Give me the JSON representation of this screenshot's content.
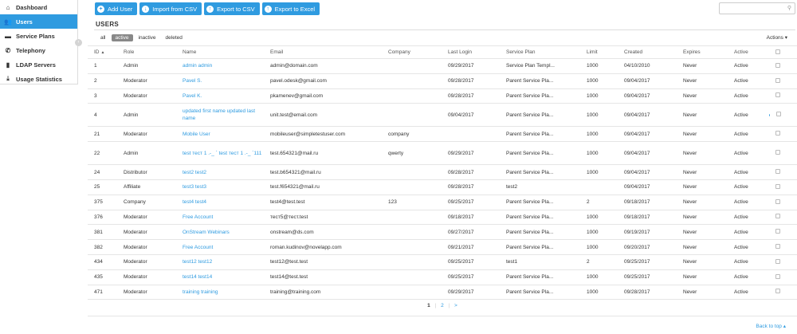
{
  "sidebar": {
    "items": [
      {
        "label": "Dashboard",
        "icon": "home-icon",
        "glyph": "⌂",
        "active": false
      },
      {
        "label": "Users",
        "icon": "users-icon",
        "glyph": "👥",
        "active": true
      },
      {
        "label": "Service Plans",
        "icon": "folder-icon",
        "glyph": "▬",
        "active": false
      },
      {
        "label": "Telephony",
        "icon": "phone-icon",
        "glyph": "✆",
        "active": false
      },
      {
        "label": "LDAP Servers",
        "icon": "server-icon",
        "glyph": "▮",
        "active": false
      },
      {
        "label": "Usage Statistics",
        "icon": "download-icon",
        "glyph": "⤓",
        "active": false
      }
    ],
    "collapse_glyph": "‹"
  },
  "toolbar": {
    "add_user": "Add User",
    "import_csv": "Import from CSV",
    "export_csv": "Export to CSV",
    "export_excel": "Export to Excel"
  },
  "search": {
    "placeholder": ""
  },
  "page": {
    "title": "USERS"
  },
  "filters": {
    "all": "all",
    "active": "active",
    "inactive": "inactive",
    "deleted": "deleted"
  },
  "actions_label": "Actions ▾",
  "table": {
    "columns": [
      "ID",
      "Role",
      "Name",
      "Email",
      "Company",
      "Last Login",
      "Service Plan",
      "Limit",
      "Created",
      "Expires",
      "Active"
    ],
    "rows": [
      {
        "id": "1",
        "role": "Admin",
        "name": "admin admin",
        "email": "admin@domain.com",
        "company": "",
        "last_login": "09/29/2017",
        "plan": "Service Plan Templ...",
        "limit": "1000",
        "created": "04/10/2010",
        "expires": "Never",
        "active": "Active",
        "dot": false
      },
      {
        "id": "2",
        "role": "Moderator",
        "name": "Pavel S.",
        "email": "pavel.odesk@gmail.com",
        "company": "",
        "last_login": "09/28/2017",
        "plan": "Parent Service Pla...",
        "limit": "1000",
        "created": "09/04/2017",
        "expires": "Never",
        "active": "Active",
        "dot": false
      },
      {
        "id": "3",
        "role": "Moderator",
        "name": "Pavel K.",
        "email": "pkamenev@gmail.com",
        "company": "",
        "last_login": "09/28/2017",
        "plan": "Parent Service Pla...",
        "limit": "1000",
        "created": "09/04/2017",
        "expires": "Never",
        "active": "Active",
        "dot": false
      },
      {
        "id": "4",
        "role": "Admin",
        "name": "updated first name updated last name",
        "email": "unit.test@email.com",
        "company": "",
        "last_login": "09/04/2017",
        "plan": "Parent Service Pla...",
        "limit": "1000",
        "created": "09/04/2017",
        "expires": "Never",
        "active": "Active",
        "dot": true
      },
      {
        "id": "21",
        "role": "Moderator",
        "name": "Mobile User",
        "email": "mobileuser@simpletestuser.com",
        "company": "company",
        "last_login": "",
        "plan": "Parent Service Pla...",
        "limit": "1000",
        "created": "09/04/2017",
        "expires": "Never",
        "active": "Active",
        "dot": false
      },
      {
        "id": "22",
        "role": "Admin",
        "name": "test тест 1 .-_ ` test тест 1 .-_ `111",
        "email": "test.654321@mail.ru",
        "company": "qwerty",
        "last_login": "09/29/2017",
        "plan": "Parent Service Pla...",
        "limit": "1000",
        "created": "09/04/2017",
        "expires": "Never",
        "active": "Active",
        "dot": false
      },
      {
        "id": "24",
        "role": "Distributor",
        "name": "test2 test2",
        "email": "test.b654321@mail.ru",
        "company": "",
        "last_login": "09/28/2017",
        "plan": "Parent Service Pla...",
        "limit": "1000",
        "created": "09/04/2017",
        "expires": "Never",
        "active": "Active",
        "dot": false
      },
      {
        "id": "25",
        "role": "Affiliate",
        "name": "test3 test3",
        "email": "test.f654321@mail.ru",
        "company": "",
        "last_login": "09/28/2017",
        "plan": "test2",
        "limit": "",
        "created": "09/04/2017",
        "expires": "Never",
        "active": "Active",
        "dot": false
      },
      {
        "id": "375",
        "role": "Company",
        "name": "test4 test4",
        "email": "test4@test.test",
        "company": "123",
        "last_login": "09/25/2017",
        "plan": "Parent Service Pla...",
        "limit": "2",
        "created": "09/18/2017",
        "expires": "Never",
        "active": "Active",
        "dot": false
      },
      {
        "id": "376",
        "role": "Moderator",
        "name": "Free Account",
        "email": "тест5@тест.test",
        "company": "",
        "last_login": "09/18/2017",
        "plan": "Parent Service Pla...",
        "limit": "1000",
        "created": "09/18/2017",
        "expires": "Never",
        "active": "Active",
        "dot": false
      },
      {
        "id": "381",
        "role": "Moderator",
        "name": "OnStream Webinars",
        "email": "onstream@ds.com",
        "company": "",
        "last_login": "09/27/2017",
        "plan": "Parent Service Pla...",
        "limit": "1000",
        "created": "09/19/2017",
        "expires": "Never",
        "active": "Active",
        "dot": false
      },
      {
        "id": "382",
        "role": "Moderator",
        "name": "Free Account",
        "email": "roman.kudinov@novelapp.com",
        "company": "",
        "last_login": "09/21/2017",
        "plan": "Parent Service Pla...",
        "limit": "1000",
        "created": "09/20/2017",
        "expires": "Never",
        "active": "Active",
        "dot": false
      },
      {
        "id": "434",
        "role": "Moderator",
        "name": "test12 test12",
        "email": "test12@test.test",
        "company": "",
        "last_login": "09/25/2017",
        "plan": "test1",
        "limit": "2",
        "created": "09/25/2017",
        "expires": "Never",
        "active": "Active",
        "dot": false
      },
      {
        "id": "435",
        "role": "Moderator",
        "name": "test14 test14",
        "email": "test14@test.test",
        "company": "",
        "last_login": "09/25/2017",
        "plan": "Parent Service Pla...",
        "limit": "1000",
        "created": "09/25/2017",
        "expires": "Never",
        "active": "Active",
        "dot": false
      },
      {
        "id": "471",
        "role": "Moderator",
        "name": "training training",
        "email": "training@training.com",
        "company": "",
        "last_login": "09/29/2017",
        "plan": "Parent Service Pla...",
        "limit": "1000",
        "created": "09/28/2017",
        "expires": "Never",
        "active": "Active",
        "dot": false
      }
    ]
  },
  "pagination": {
    "current": "1",
    "next_page": "2",
    "next": ">",
    "sep": "|"
  },
  "footer": {
    "back_to_top": "Back to top ▴"
  },
  "colors": {
    "accent": "#2f9be0",
    "active_filter": "#888888"
  }
}
